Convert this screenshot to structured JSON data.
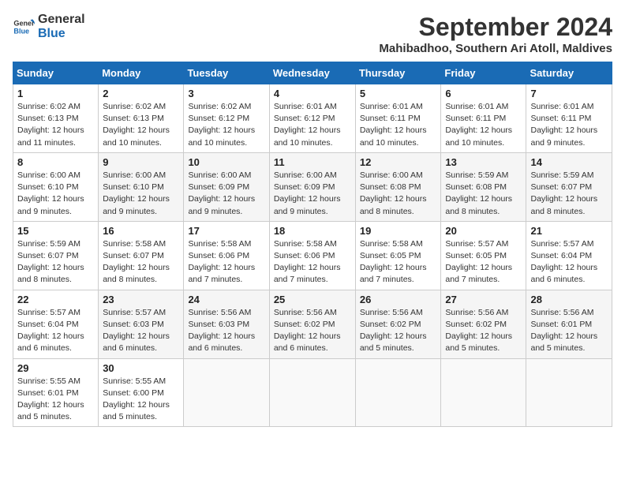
{
  "logo": {
    "line1": "General",
    "line2": "Blue"
  },
  "title": "September 2024",
  "subtitle": "Mahibadhoo, Southern Ari Atoll, Maldives",
  "days_of_week": [
    "Sunday",
    "Monday",
    "Tuesday",
    "Wednesday",
    "Thursday",
    "Friday",
    "Saturday"
  ],
  "weeks": [
    [
      {
        "num": "1",
        "sunrise": "6:02 AM",
        "sunset": "6:13 PM",
        "daylight": "12 hours and 11 minutes."
      },
      {
        "num": "2",
        "sunrise": "6:02 AM",
        "sunset": "6:13 PM",
        "daylight": "12 hours and 10 minutes."
      },
      {
        "num": "3",
        "sunrise": "6:02 AM",
        "sunset": "6:12 PM",
        "daylight": "12 hours and 10 minutes."
      },
      {
        "num": "4",
        "sunrise": "6:01 AM",
        "sunset": "6:12 PM",
        "daylight": "12 hours and 10 minutes."
      },
      {
        "num": "5",
        "sunrise": "6:01 AM",
        "sunset": "6:11 PM",
        "daylight": "12 hours and 10 minutes."
      },
      {
        "num": "6",
        "sunrise": "6:01 AM",
        "sunset": "6:11 PM",
        "daylight": "12 hours and 10 minutes."
      },
      {
        "num": "7",
        "sunrise": "6:01 AM",
        "sunset": "6:11 PM",
        "daylight": "12 hours and 9 minutes."
      }
    ],
    [
      {
        "num": "8",
        "sunrise": "6:00 AM",
        "sunset": "6:10 PM",
        "daylight": "12 hours and 9 minutes."
      },
      {
        "num": "9",
        "sunrise": "6:00 AM",
        "sunset": "6:10 PM",
        "daylight": "12 hours and 9 minutes."
      },
      {
        "num": "10",
        "sunrise": "6:00 AM",
        "sunset": "6:09 PM",
        "daylight": "12 hours and 9 minutes."
      },
      {
        "num": "11",
        "sunrise": "6:00 AM",
        "sunset": "6:09 PM",
        "daylight": "12 hours and 9 minutes."
      },
      {
        "num": "12",
        "sunrise": "6:00 AM",
        "sunset": "6:08 PM",
        "daylight": "12 hours and 8 minutes."
      },
      {
        "num": "13",
        "sunrise": "5:59 AM",
        "sunset": "6:08 PM",
        "daylight": "12 hours and 8 minutes."
      },
      {
        "num": "14",
        "sunrise": "5:59 AM",
        "sunset": "6:07 PM",
        "daylight": "12 hours and 8 minutes."
      }
    ],
    [
      {
        "num": "15",
        "sunrise": "5:59 AM",
        "sunset": "6:07 PM",
        "daylight": "12 hours and 8 minutes."
      },
      {
        "num": "16",
        "sunrise": "5:58 AM",
        "sunset": "6:07 PM",
        "daylight": "12 hours and 8 minutes."
      },
      {
        "num": "17",
        "sunrise": "5:58 AM",
        "sunset": "6:06 PM",
        "daylight": "12 hours and 7 minutes."
      },
      {
        "num": "18",
        "sunrise": "5:58 AM",
        "sunset": "6:06 PM",
        "daylight": "12 hours and 7 minutes."
      },
      {
        "num": "19",
        "sunrise": "5:58 AM",
        "sunset": "6:05 PM",
        "daylight": "12 hours and 7 minutes."
      },
      {
        "num": "20",
        "sunrise": "5:57 AM",
        "sunset": "6:05 PM",
        "daylight": "12 hours and 7 minutes."
      },
      {
        "num": "21",
        "sunrise": "5:57 AM",
        "sunset": "6:04 PM",
        "daylight": "12 hours and 6 minutes."
      }
    ],
    [
      {
        "num": "22",
        "sunrise": "5:57 AM",
        "sunset": "6:04 PM",
        "daylight": "12 hours and 6 minutes."
      },
      {
        "num": "23",
        "sunrise": "5:57 AM",
        "sunset": "6:03 PM",
        "daylight": "12 hours and 6 minutes."
      },
      {
        "num": "24",
        "sunrise": "5:56 AM",
        "sunset": "6:03 PM",
        "daylight": "12 hours and 6 minutes."
      },
      {
        "num": "25",
        "sunrise": "5:56 AM",
        "sunset": "6:02 PM",
        "daylight": "12 hours and 6 minutes."
      },
      {
        "num": "26",
        "sunrise": "5:56 AM",
        "sunset": "6:02 PM",
        "daylight": "12 hours and 5 minutes."
      },
      {
        "num": "27",
        "sunrise": "5:56 AM",
        "sunset": "6:02 PM",
        "daylight": "12 hours and 5 minutes."
      },
      {
        "num": "28",
        "sunrise": "5:56 AM",
        "sunset": "6:01 PM",
        "daylight": "12 hours and 5 minutes."
      }
    ],
    [
      {
        "num": "29",
        "sunrise": "5:55 AM",
        "sunset": "6:01 PM",
        "daylight": "12 hours and 5 minutes."
      },
      {
        "num": "30",
        "sunrise": "5:55 AM",
        "sunset": "6:00 PM",
        "daylight": "12 hours and 5 minutes."
      },
      null,
      null,
      null,
      null,
      null
    ]
  ]
}
